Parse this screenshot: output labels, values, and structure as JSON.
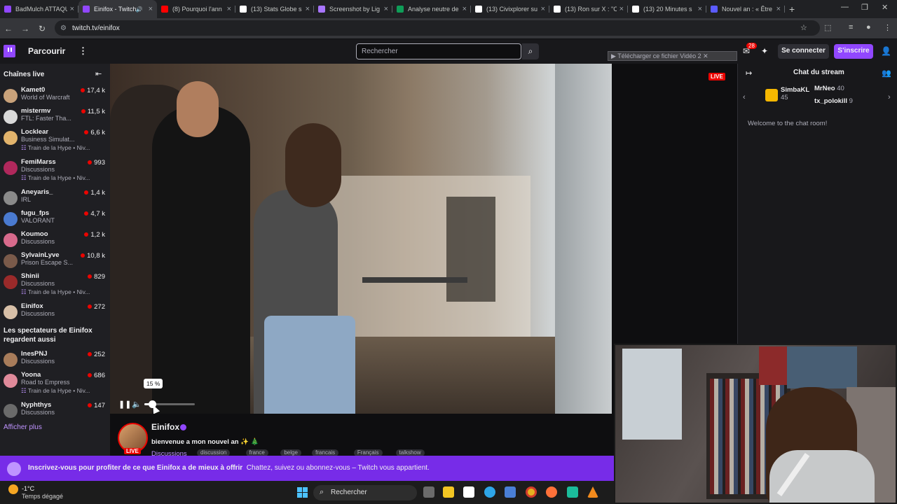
{
  "browser": {
    "tabs": [
      {
        "title": "BadMulch ATTAQU",
        "color": "#9147ff"
      },
      {
        "title": "Einifox - Twitch",
        "color": "#9147ff",
        "active": true,
        "audio": true
      },
      {
        "title": "(8) Pourquoi l'ann",
        "color": "#ff0000"
      },
      {
        "title": "(13) Stats Globe s",
        "color": "#ffffff"
      },
      {
        "title": "Screenshot by Lig",
        "color": "#a875ff"
      },
      {
        "title": "Analyse neutre de",
        "color": "#0f9d58"
      },
      {
        "title": "(13) Civixplorer su",
        "color": "#ffffff"
      },
      {
        "title": "(13) Ron sur X : \"C",
        "color": "#ffffff"
      },
      {
        "title": "(13) 20 Minutes s",
        "color": "#ffffff"
      },
      {
        "title": "Nouvel an : « Être",
        "color": "#5b5bff"
      }
    ],
    "new_tab": "+",
    "url": "twitch.tv/einifox"
  },
  "twitch_nav": {
    "browse": "Parcourir",
    "search_placeholder": "Rechercher",
    "download_bar": "▶ Télécharger ce fichier Vidéo  2 ✕",
    "notifications": "28",
    "login": "Se connecter",
    "signup": "S'inscrire"
  },
  "sidebar": {
    "live_heading": "Chaînes live",
    "channels": [
      {
        "name": "Kamet0",
        "category": "World of Warcraft",
        "viewers": "17,4 k",
        "color": "#c9a27a"
      },
      {
        "name": "mistermv",
        "category": "FTL: Faster Tha...",
        "viewers": "11,5 k",
        "color": "#d9d9d9"
      },
      {
        "name": "Locklear",
        "category": "Business Simulat...",
        "hype": "Train de la Hype • Niv...",
        "viewers": "6,6 k",
        "color": "#e3b46c"
      },
      {
        "name": "FemiMarss",
        "category": "Discussions",
        "hype": "Train de la Hype • Niv...",
        "viewers": "993",
        "color": "#b0285c"
      },
      {
        "name": "Aneyaris_",
        "category": "IRL",
        "viewers": "1,4 k",
        "color": "#8a8a8a"
      },
      {
        "name": "fugu_fps",
        "category": "VALORANT",
        "viewers": "4,7 k",
        "color": "#4a7ad0"
      },
      {
        "name": "Koumoo",
        "category": "Discussions",
        "viewers": "1,2 k",
        "color": "#d86a8c"
      },
      {
        "name": "SylvainLyve",
        "category": "Prison Escape S...",
        "viewers": "10,8 k",
        "color": "#7a5a4a"
      },
      {
        "name": "Shinii",
        "category": "Discussions",
        "hype": "Train de la Hype • Niv...",
        "viewers": "829",
        "color": "#9a2a2a"
      },
      {
        "name": "Einifox",
        "category": "Discussions",
        "viewers": "272",
        "color": "#d8c0a8"
      }
    ],
    "also_heading": "Les spectateurs de Einifox regardent aussi",
    "also": [
      {
        "name": "InesPNJ",
        "category": "Discussions",
        "viewers": "252",
        "color": "#a87c5a"
      },
      {
        "name": "Yoona",
        "category": "Road to Empress",
        "hype": "Train de la Hype • Niv...",
        "viewers": "686",
        "color": "#e08a9a"
      },
      {
        "name": "Nyphthys",
        "category": "Discussions",
        "viewers": "147",
        "color": "#6a6a6a"
      }
    ],
    "show_more": "Afficher plus"
  },
  "player": {
    "live_badge": "LIVE",
    "volume_tooltip": "15 %",
    "volume": 0.15
  },
  "channel": {
    "name": "Einifox",
    "title": "bienvenue a mon nouvel an ✨ 🎄",
    "category": "Discussions",
    "live": "LIVE",
    "tags": [
      "discussion",
      "france",
      "belge",
      "francais",
      "Français",
      "talkshow"
    ]
  },
  "banner": {
    "bold": "Inscrivez-vous pour profiter de ce que Einifox a de mieux à offrir",
    "rest": "Chattez, suivez ou abonnez-vous – Twitch vous appartient."
  },
  "chat": {
    "title": "Chat du stream",
    "leaders": [
      {
        "name": "SimbaKL",
        "score": "45"
      },
      {
        "name": "MrNeo",
        "score": "40"
      },
      {
        "name": "tx_polokill",
        "score": "9"
      }
    ],
    "welcome": "Welcome to the chat room!"
  },
  "taskbar": {
    "temp": "-1°C",
    "weather": "Temps dégagé",
    "search": "Rechercher"
  }
}
